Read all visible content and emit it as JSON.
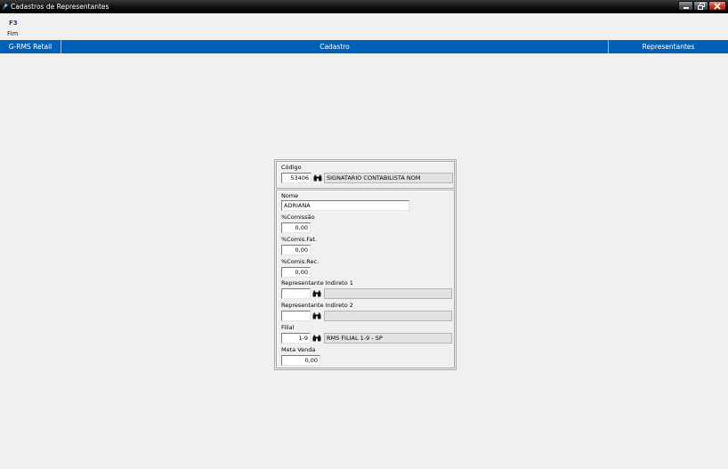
{
  "window": {
    "title": "Cadastros de Representantes"
  },
  "toolbar": {
    "shortcut_key": "F3",
    "shortcut_label": "Fim"
  },
  "nav": {
    "app": "G-RMS Retail",
    "module": "Cadastro",
    "screen": "Representantes"
  },
  "form": {
    "codigo": {
      "label": "Código",
      "value": "53406",
      "description": "SIGNATARIO CONTABILISTA NOM"
    },
    "nome": {
      "label": "Nome",
      "value": "ADRIANA"
    },
    "comissao": {
      "label": "%Comissão",
      "value": "0,00"
    },
    "comis_fat": {
      "label": "%Comis.Fat.",
      "value": "0,00"
    },
    "comis_rec": {
      "label": "%Comis.Rec.",
      "value": "0,00"
    },
    "rep_indireto_1": {
      "label": "Representante Indireto 1",
      "value": "",
      "description": ""
    },
    "rep_indireto_2": {
      "label": "Representante Indireto 2",
      "value": "",
      "description": ""
    },
    "filial": {
      "label": "Filial",
      "value": "1-9",
      "description": "RMS FILIAL 1-9 - SP"
    },
    "meta_venda": {
      "label": "Meta Venda",
      "value": "0,00"
    }
  },
  "icons": {
    "lookup": "binoculars-icon",
    "app": "app-icon"
  },
  "colors": {
    "nav_bar": "#0060b8",
    "title_bar": "#000000",
    "close_button": "#c4402a"
  }
}
